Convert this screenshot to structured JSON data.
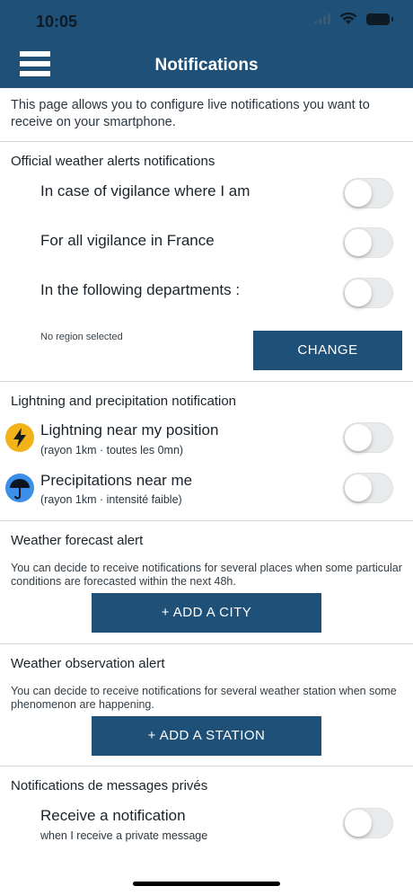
{
  "status_bar": {
    "time": "10:05"
  },
  "header": {
    "title": "Notifications"
  },
  "intro": "This page allows you to configure live notifications you want to receive on your smartphone.",
  "official": {
    "title": "Official weather alerts notifications",
    "items": [
      {
        "label": "In case of vigilance where I am",
        "on": false
      },
      {
        "label": "For all vigilance in France",
        "on": false
      },
      {
        "label": "In the following departments :",
        "on": false
      }
    ],
    "region_note": "No region selected",
    "change_label": "CHANGE"
  },
  "lightning": {
    "title": "Lightning and precipitation notification",
    "items": [
      {
        "label": "Lightning near my position",
        "sub": "(rayon 1km · toutes les 0mn)",
        "icon": "lightning-icon",
        "icon_color": "#f2b21a",
        "on": false
      },
      {
        "label": "Precipitations near me",
        "sub": "(rayon 1km · intensité faible)",
        "icon": "umbrella-icon",
        "icon_color": "#3b8fe8",
        "on": false
      }
    ]
  },
  "forecast": {
    "title": "Weather forecast alert",
    "desc": "You can decide to receive notifications for several places when some particular conditions are forecasted within the next 48h.",
    "button": "+ ADD A CITY"
  },
  "observation": {
    "title": "Weather observation alert",
    "desc": "You can decide to receive notifications for several weather station when some phenomenon are happening.",
    "button": "+ ADD A STATION"
  },
  "private_messages": {
    "title": "Notifications de messages privés",
    "label": "Receive a notification",
    "sub": "when I receive a private message",
    "on": false
  },
  "colors": {
    "header": "#1f5078",
    "button": "#1f5078",
    "toggle_off": "#e9eaec"
  }
}
